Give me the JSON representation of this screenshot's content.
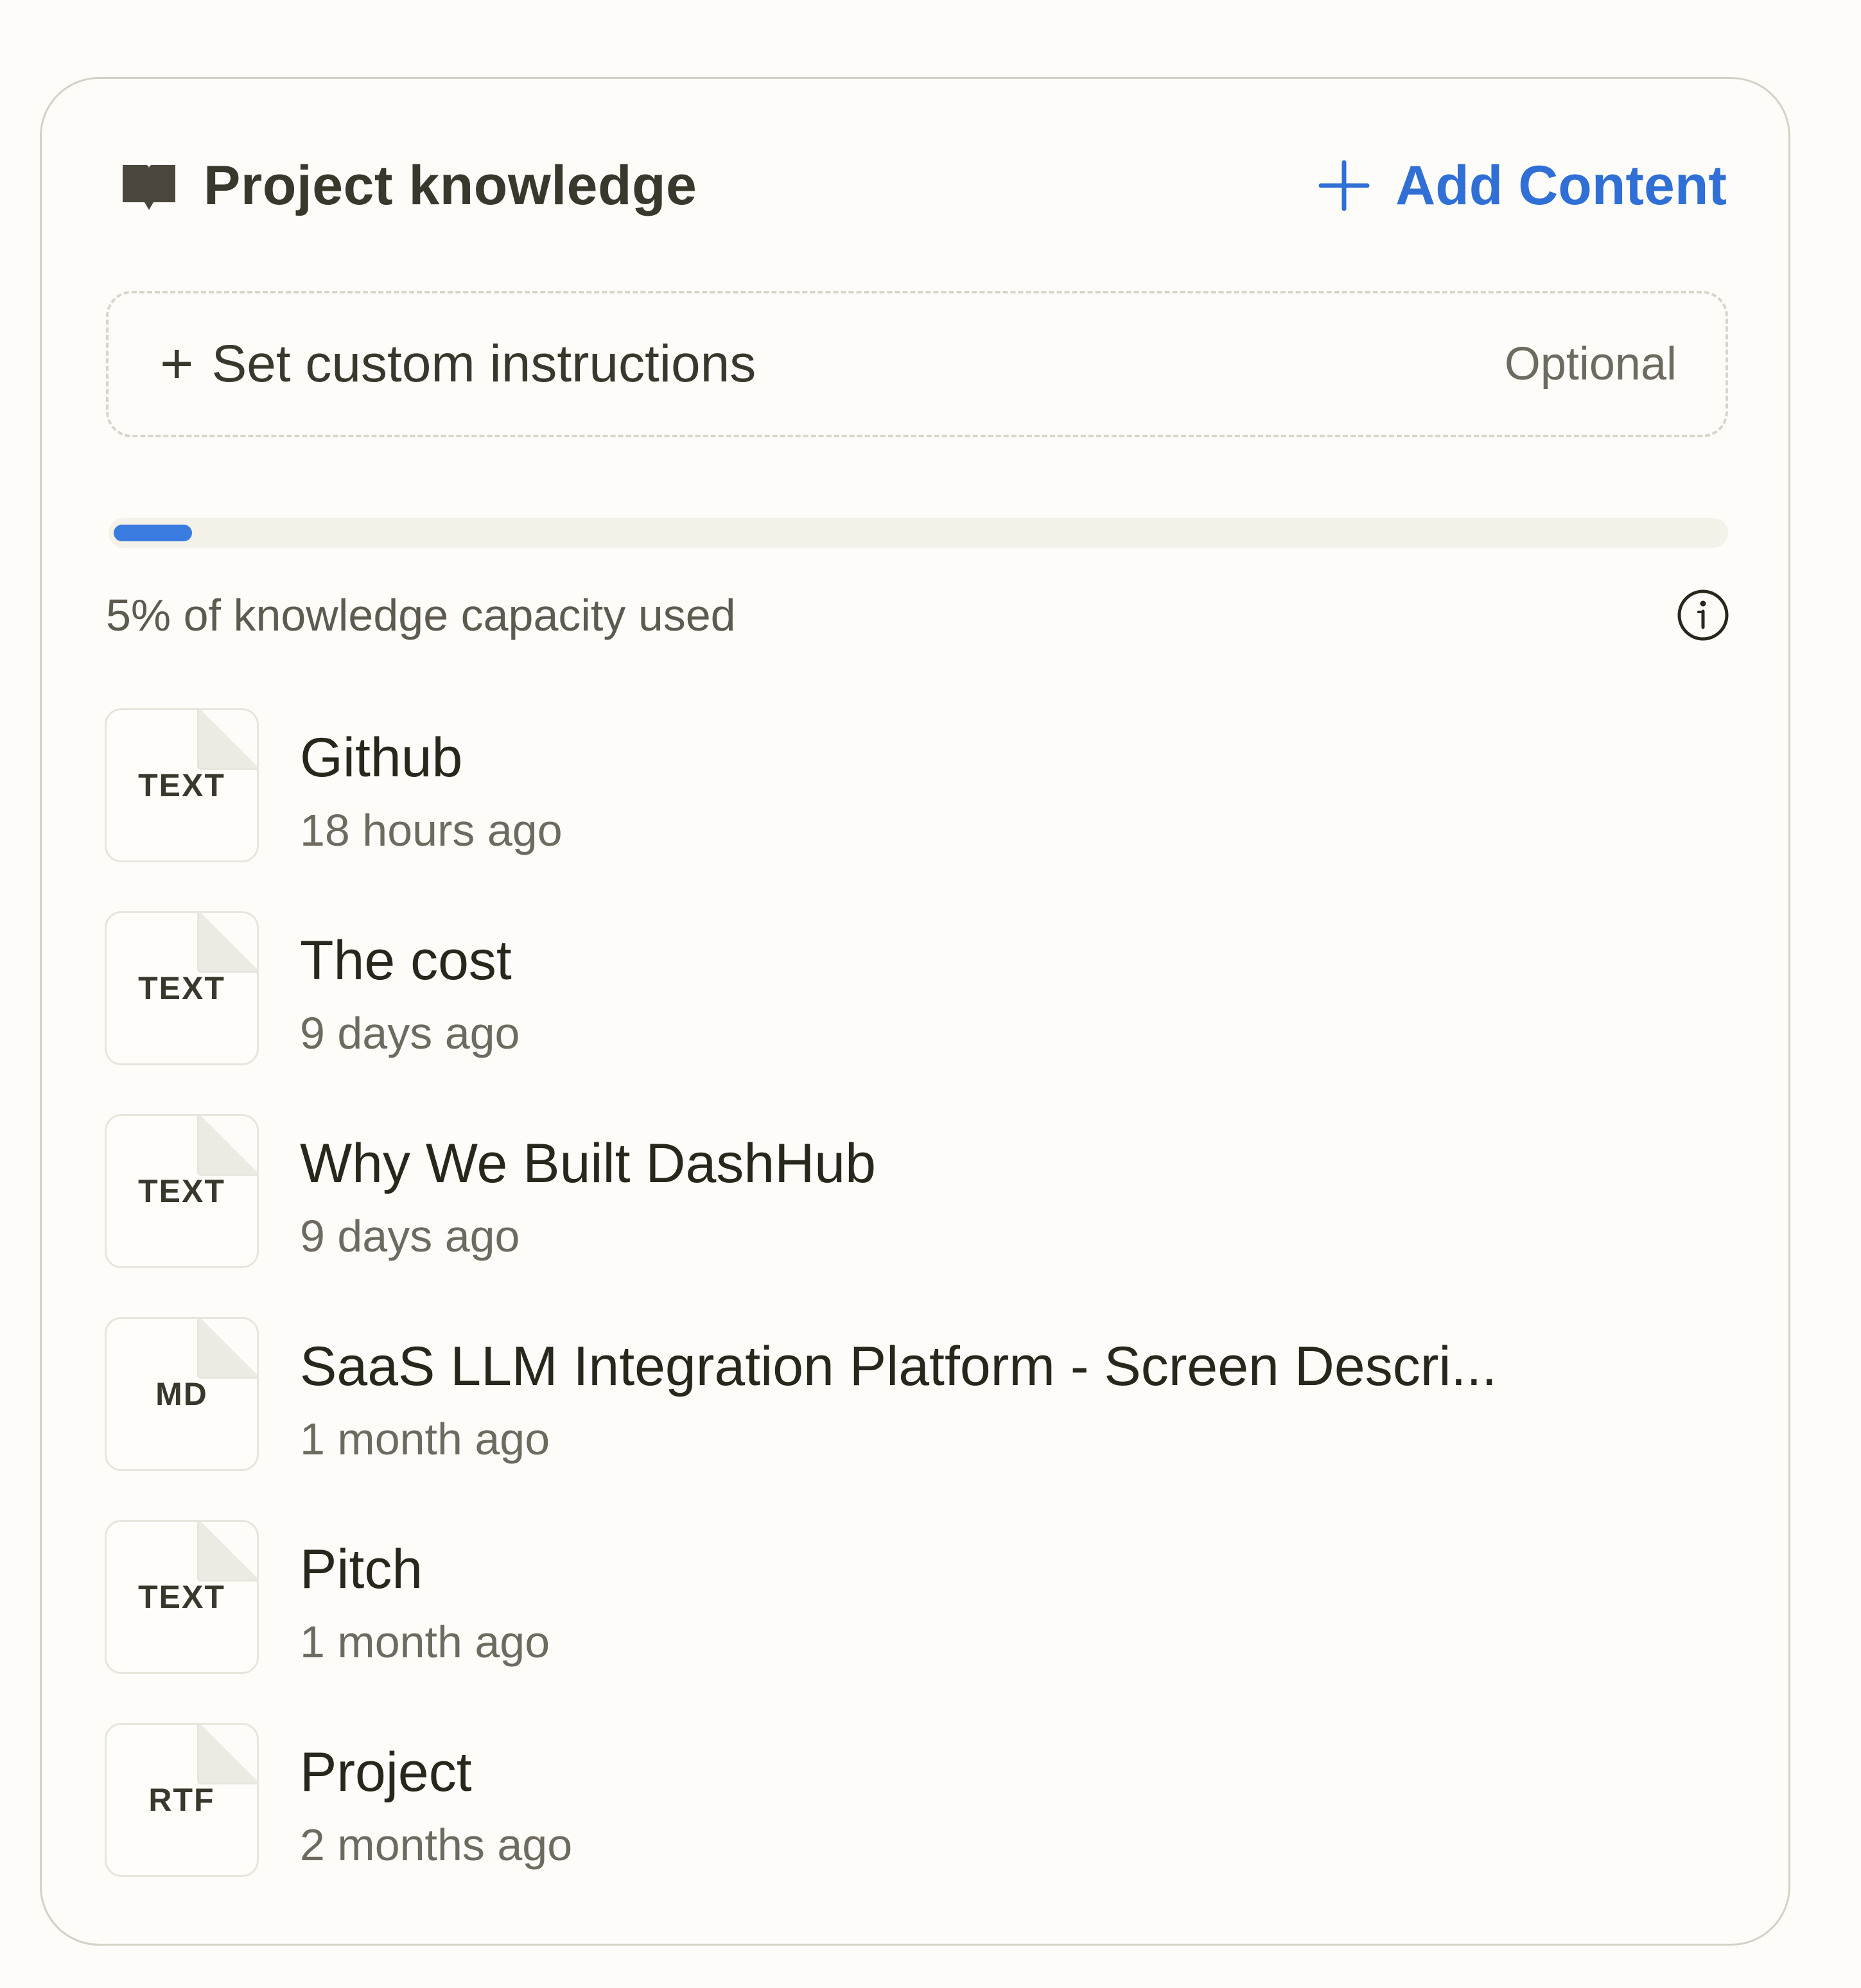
{
  "header": {
    "title": "Project knowledge",
    "add_content_label": "Add Content",
    "icon": "book-open-icon"
  },
  "instructions": {
    "label": "Set custom instructions",
    "optional_label": "Optional"
  },
  "capacity": {
    "percent_used": 5,
    "text": "5% of knowledge capacity used"
  },
  "colors": {
    "accent": "#2f6fd6",
    "progress_fill": "#3a7be0",
    "background": "#fdfcf8"
  },
  "files": [
    {
      "type": "TEXT",
      "name": "Github",
      "time": "18 hours ago"
    },
    {
      "type": "TEXT",
      "name": "The cost",
      "time": "9 days ago"
    },
    {
      "type": "TEXT",
      "name": "Why We Built DashHub",
      "time": "9 days ago"
    },
    {
      "type": "MD",
      "name": "SaaS LLM Integration Platform - Screen Descri...",
      "time": "1 month ago"
    },
    {
      "type": "TEXT",
      "name": "Pitch",
      "time": "1 month ago"
    },
    {
      "type": "RTF",
      "name": "Project",
      "time": "2 months ago"
    }
  ]
}
